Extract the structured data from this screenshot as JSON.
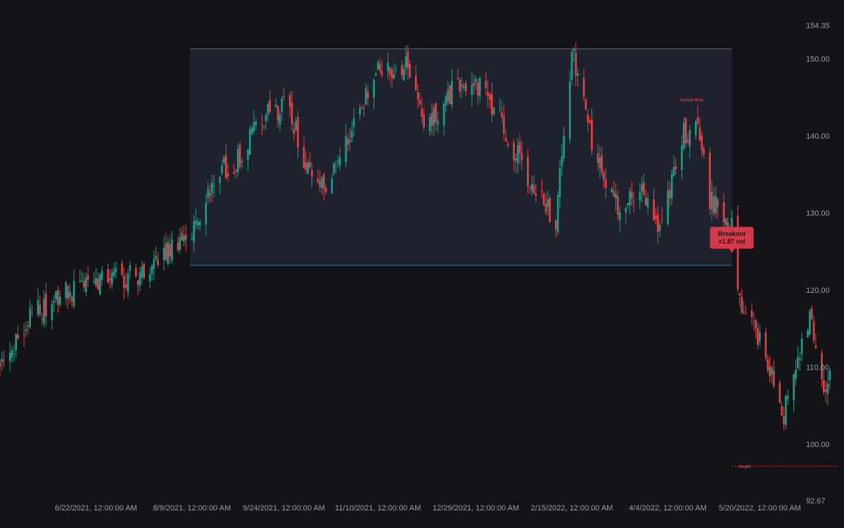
{
  "chart_data": {
    "type": "candlestick",
    "colors": {
      "background": "#131417",
      "up": "#1f9d8a",
      "down": "#e2434b",
      "range_fill": "#1d222c",
      "range_border": "#3e6fb8",
      "callout": "#d23a4c",
      "target": "#c8323f"
    },
    "y_axis": {
      "min": 92.67,
      "max": 154.35,
      "ticks": [
        "154.35",
        "150.00",
        "140.00",
        "130.00",
        "120.00",
        "110.00",
        "100.00",
        "92.67"
      ],
      "position": "right"
    },
    "x_axis": {
      "start": "2021-05-05",
      "end": "2022-06-10",
      "ticks": [
        "6/22/2021, 12:00:00 AM",
        "8/9/2021, 12:00:00 AM",
        "9/24/2021, 12:00:00 AM",
        "11/10/2021, 12:00:00 AM",
        "12/29/2021, 12:00:00 AM",
        "2/15/2022, 12:00:00 AM",
        "4/4/2022, 12:00:00 AM",
        "5/20/2022, 12:00:00 AM"
      ],
      "tick_dates": [
        "2021-06-22",
        "2021-08-09",
        "2021-09-24",
        "2021-11-10",
        "2021-12-29",
        "2022-02-15",
        "2022-04-04",
        "2022-05-20"
      ]
    },
    "price_path": [
      [
        "2021-05-05",
        110
      ],
      [
        "2021-05-19",
        116
      ],
      [
        "2021-06-01",
        119
      ],
      [
        "2021-06-22",
        121
      ],
      [
        "2021-07-13",
        122
      ],
      [
        "2021-07-25",
        125
      ],
      [
        "2021-08-04",
        127
      ],
      [
        "2021-08-08",
        126
      ],
      [
        "2021-08-20",
        135
      ],
      [
        "2021-09-01",
        137
      ],
      [
        "2021-09-12",
        142
      ],
      [
        "2021-09-26",
        144
      ],
      [
        "2021-10-05",
        136
      ],
      [
        "2021-10-15",
        134
      ],
      [
        "2021-10-28",
        141
      ],
      [
        "2021-11-10",
        148
      ],
      [
        "2021-11-24",
        149
      ],
      [
        "2021-12-05",
        141
      ],
      [
        "2021-12-20",
        147
      ],
      [
        "2022-01-02",
        146
      ],
      [
        "2022-01-12",
        141
      ],
      [
        "2022-01-25",
        134
      ],
      [
        "2022-02-07",
        129
      ],
      [
        "2022-02-15",
        151
      ],
      [
        "2022-02-27",
        137
      ],
      [
        "2022-03-11",
        130
      ],
      [
        "2022-03-22",
        133
      ],
      [
        "2022-04-01",
        128
      ],
      [
        "2022-04-11",
        140
      ],
      [
        "2022-04-19",
        142
      ],
      [
        "2022-04-25",
        132
      ],
      [
        "2022-05-06",
        128
      ],
      [
        "2022-05-08",
        120
      ],
      [
        "2022-05-23",
        112
      ],
      [
        "2022-06-01",
        104
      ],
      [
        "2022-06-07",
        110
      ],
      [
        "2022-06-14",
        117
      ],
      [
        "2022-06-22",
        107
      ],
      [
        "2022-06-26",
        109
      ]
    ],
    "range_box": {
      "start": "2021-08-08",
      "end": "2022-05-06",
      "top": 151.3,
      "bottom": 123.2
    },
    "annotations": {
      "partial_rise": {
        "label": "Partial Rise",
        "date": "2022-04-16",
        "price": 144.5
      },
      "breakout": {
        "line1": "Breakout",
        "line2": "×1.87 vol",
        "date": "2022-05-06",
        "price": 125
      },
      "target": {
        "label": "target",
        "price": 97.1,
        "start": "2022-05-06",
        "end": "2022-06-28"
      }
    }
  }
}
